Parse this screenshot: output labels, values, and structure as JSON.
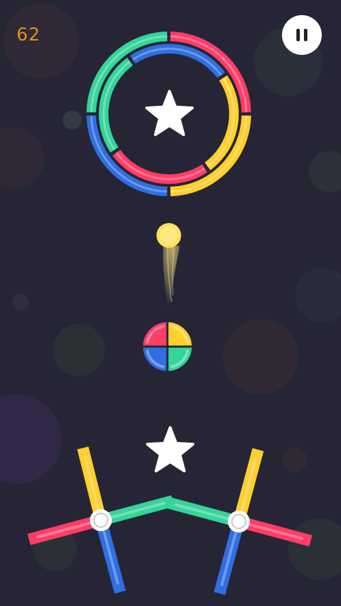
{
  "hud": {
    "score": "62",
    "pause_icon": "pause-icon"
  },
  "colors": {
    "background": "#252536",
    "red": "#ff3d67",
    "yellow": "#ffcf2e",
    "teal": "#35d49b",
    "blue": "#2f6fe0",
    "ball": "#ffe15a",
    "star": "#ffffff",
    "score": "#e0901f"
  },
  "icons": {
    "top_star": "star-icon",
    "bottom_star": "star-icon"
  },
  "game": {
    "ball_color": "yellow",
    "outer_ring_colors": [
      "red",
      "yellow",
      "blue",
      "teal"
    ],
    "inner_ring_colors": [
      "blue",
      "yellow",
      "red",
      "teal"
    ],
    "color_switcher_quadrants": [
      "yellow",
      "teal",
      "blue",
      "red"
    ],
    "left_cross_arms": [
      "yellow",
      "teal",
      "blue",
      "red"
    ],
    "right_cross_arms": [
      "yellow",
      "red",
      "blue",
      "teal"
    ]
  }
}
